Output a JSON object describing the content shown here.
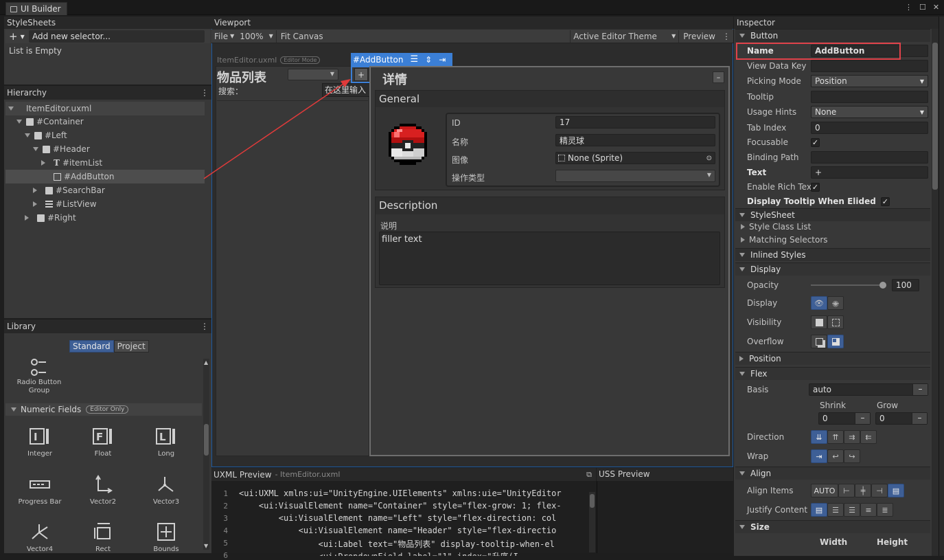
{
  "window": {
    "tab_title": "UI Builder"
  },
  "stylesheets": {
    "title": "StyleSheets",
    "add_selector_placeholder": "Add new selector...",
    "empty_text": "List is Empty"
  },
  "hierarchy": {
    "title": "Hierarchy",
    "items": [
      "ItemEditor.uxml",
      "#Container",
      "#Left",
      "#Header",
      "#itemList",
      "#AddButton",
      "#SearchBar",
      "#ListView",
      "#Right"
    ]
  },
  "library": {
    "title": "Library",
    "tabs": [
      "Standard",
      "Project"
    ],
    "radio_button_group": "Radio Button Group",
    "numeric_fields": "Numeric Fields",
    "editor_only_badge": "Editor Only",
    "items": [
      "Integer",
      "Float",
      "Long",
      "Progress Bar",
      "Vector2",
      "Vector3",
      "Vector4",
      "Rect",
      "Bounds"
    ]
  },
  "viewport": {
    "title": "Viewport",
    "file_menu": "File",
    "zoom": "100%",
    "fit_canvas": "Fit Canvas",
    "theme": "Active Editor Theme",
    "preview": "Preview",
    "document_name": "ItemEditor.uxml",
    "editor_mode_badge": "Editor Mode",
    "selected_label": "#AddButton",
    "list_title": "物品列表",
    "add_button_text": "+",
    "search_label": "搜索：",
    "search_placeholder": "在这里输入",
    "details_title": "详情",
    "general_title": "General",
    "fields": [
      {
        "label": "ID",
        "value": "17"
      },
      {
        "label": "名称",
        "value": "精灵球"
      },
      {
        "label": "图像",
        "value": "None (Sprite)"
      },
      {
        "label": "操作类型",
        "value": ""
      }
    ],
    "description_title": "Description",
    "description_label": "说明",
    "description_value": "filler text"
  },
  "uxml_preview": {
    "title": "UXML Preview",
    "file": "- ItemEditor.uxml",
    "lines": [
      {
        "n": "1",
        "text": "<ui:UXML xmlns:ui=\"UnityEngine.UIElements\" xmlns:uie=\"UnityEditor"
      },
      {
        "n": "2",
        "text": "    <ui:VisualElement name=\"Container\" style=\"flex-grow: 1; flex-"
      },
      {
        "n": "3",
        "text": "        <ui:VisualElement name=\"Left\" style=\"flex-direction: col"
      },
      {
        "n": "4",
        "text": "            <ui:VisualElement name=\"Header\" style=\"flex-directio"
      },
      {
        "n": "5",
        "text": "                <ui:Label text=\"物品列表\" display-tooltip-when-el"
      },
      {
        "n": "6",
        "text": "                <ui:DropdownField label=\"1\" index=\"升序(I"
      }
    ]
  },
  "uss_preview": {
    "title": "USS Preview"
  },
  "inspector": {
    "title": "Inspector",
    "button_section": "Button",
    "name_label": "Name",
    "name_value": "AddButton",
    "view_data_key": "View Data Key",
    "picking_mode_label": "Picking Mode",
    "picking_mode_value": "Position",
    "tooltip": "Tooltip",
    "usage_hints_label": "Usage Hints",
    "usage_hints_value": "None",
    "tab_index_label": "Tab Index",
    "tab_index_value": "0",
    "focusable": "Focusable",
    "binding_path": "Binding Path",
    "text_label": "Text",
    "text_value": "+",
    "enable_rich_text": "Enable Rich Text",
    "display_tooltip": "Display Tooltip When Elided",
    "stylesheet_section": "StyleSheet",
    "style_class_list": "Style Class List",
    "matching_selectors": "Matching Selectors",
    "inlined_styles": "Inlined Styles",
    "display_section": "Display",
    "opacity_label": "Opacity",
    "opacity_value": "100",
    "display_label": "Display",
    "visibility_label": "Visibility",
    "overflow_label": "Overflow",
    "position_section": "Position",
    "flex_section": "Flex",
    "basis_label": "Basis",
    "basis_value": "auto",
    "shrink_label": "Shrink",
    "shrink_value": "0",
    "grow_label": "Grow",
    "grow_value": "0",
    "direction_label": "Direction",
    "wrap_label": "Wrap",
    "align_section": "Align",
    "align_items_label": "Align Items",
    "align_auto": "AUTO",
    "justify_content_label": "Justify Content",
    "size_section": "Size",
    "width_label": "Width",
    "height_label": "Height"
  }
}
